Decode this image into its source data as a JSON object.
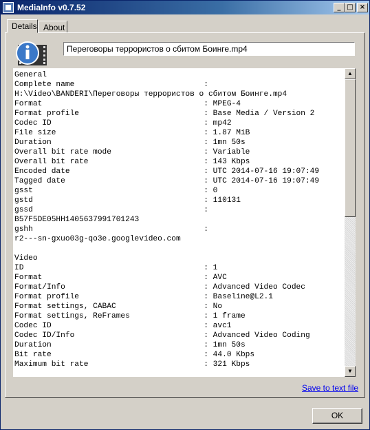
{
  "window": {
    "title": "MediaInfo v0.7.52"
  },
  "tabs": [
    {
      "label": "Details"
    },
    {
      "label": "About"
    }
  ],
  "file": {
    "name": "Переговоры террористов о сбитом Боинге.mp4"
  },
  "info_lines": [
    "General",
    "Complete name                            :",
    "H:\\Video\\BANDERI\\Переговоры террористов о сбитом Боинге.mp4",
    "Format                                   : MPEG-4",
    "Format profile                           : Base Media / Version 2",
    "Codec ID                                 : mp42",
    "File size                                : 1.87 MiB",
    "Duration                                 : 1mn 50s",
    "Overall bit rate mode                    : Variable",
    "Overall bit rate                         : 143 Kbps",
    "Encoded date                             : UTC 2014-07-16 19:07:49",
    "Tagged date                              : UTC 2014-07-16 19:07:49",
    "gsst                                     : 0",
    "gstd                                     : 110131",
    "gssd                                     :",
    "B57F5DE05HH1405637991701243",
    "gshh                                     :",
    "r2---sn-gxuo03g-qo3e.googlevideo.com",
    "",
    "Video",
    "ID                                       : 1",
    "Format                                   : AVC",
    "Format/Info                              : Advanced Video Codec",
    "Format profile                           : Baseline@L2.1",
    "Format settings, CABAC                   : No",
    "Format settings, ReFrames                : 1 frame",
    "Codec ID                                 : avc1",
    "Codec ID/Info                            : Advanced Video Coding",
    "Duration                                 : 1mn 50s",
    "Bit rate                                 : 44.0 Kbps",
    "Maximum bit rate                         : 321 Kbps"
  ],
  "footer": {
    "save_link": "Save to text file",
    "ok_label": "OK"
  },
  "icons": {
    "app": "mediainfo-app-icon",
    "info": "info-film-icon"
  }
}
